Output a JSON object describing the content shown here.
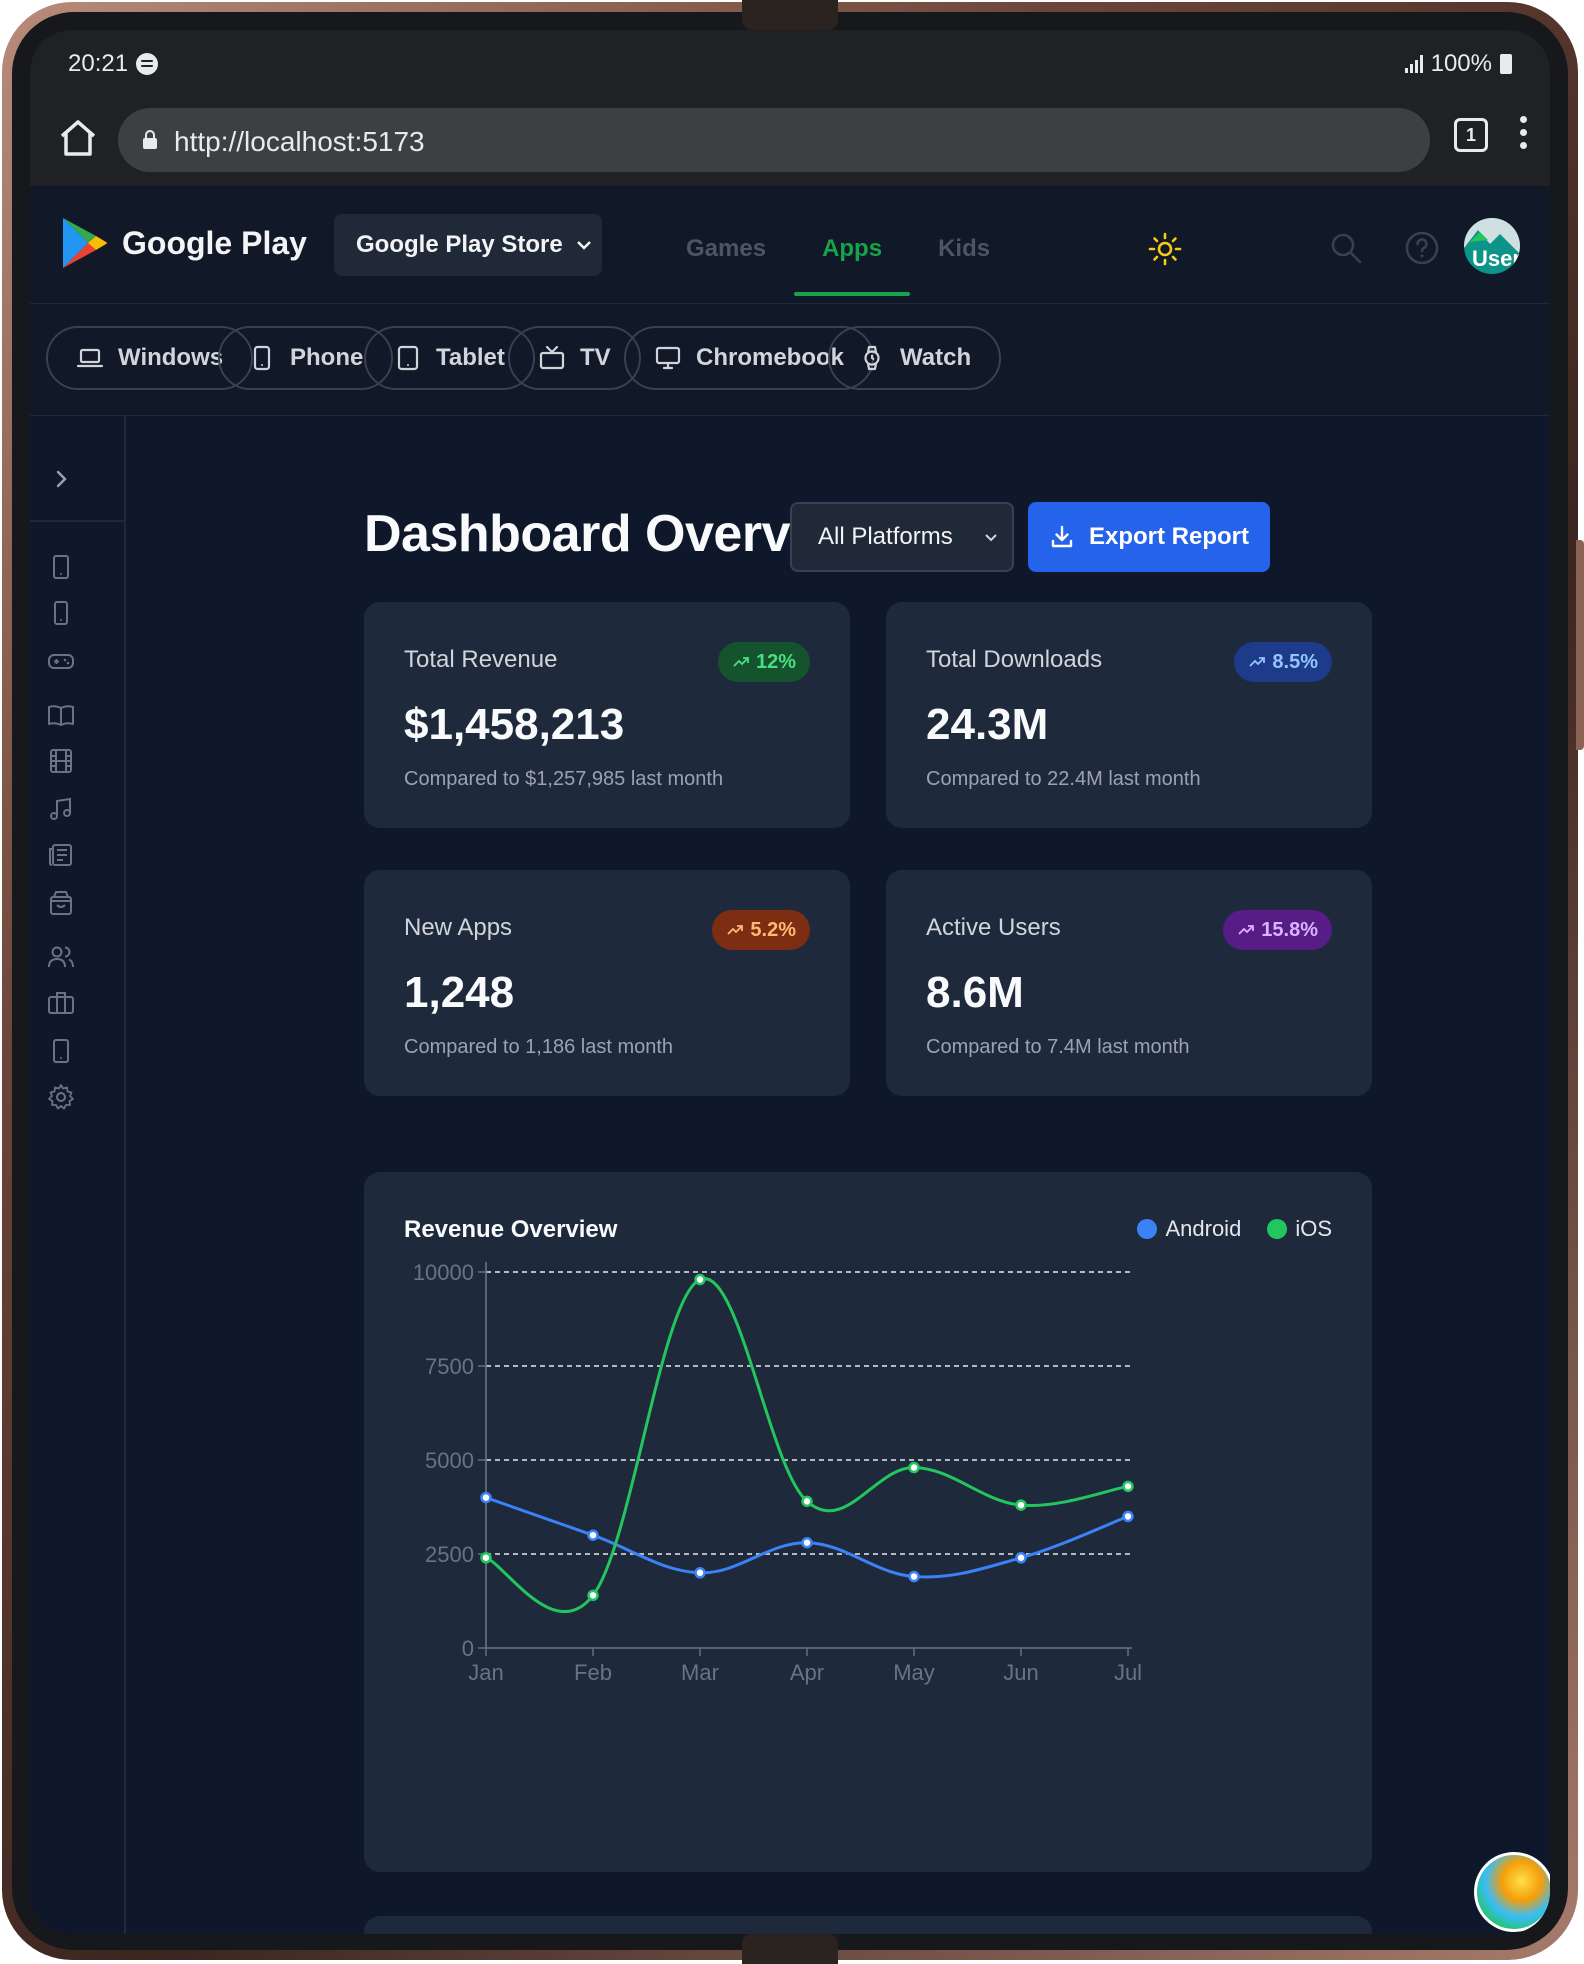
{
  "status_bar": {
    "time": "20:21",
    "battery": "100%"
  },
  "browser": {
    "url": "http://localhost:5173",
    "tab_count": "1"
  },
  "header": {
    "brand": "Google Play",
    "store_select": "Google Play Store",
    "tabs": [
      {
        "label": "Games",
        "active": false
      },
      {
        "label": "Apps",
        "active": true
      },
      {
        "label": "Kids",
        "active": false
      }
    ],
    "avatar_text": "User"
  },
  "devices": [
    {
      "label": "Windows",
      "icon": "laptop-icon"
    },
    {
      "label": "Phone",
      "icon": "phone-icon"
    },
    {
      "label": "Tablet",
      "icon": "tablet-icon"
    },
    {
      "label": "TV",
      "icon": "tv-icon"
    },
    {
      "label": "Chromebook",
      "icon": "monitor-icon"
    },
    {
      "label": "Watch",
      "icon": "watch-icon"
    }
  ],
  "sidebar": {
    "icons": [
      "tablet-icon",
      "phone-icon",
      "gamepad-icon",
      "book-icon",
      "film-icon",
      "music-icon",
      "newspaper-icon",
      "shopping-bag-icon",
      "users-icon",
      "briefcase-icon",
      "tablet-icon",
      "settings-icon"
    ]
  },
  "dashboard": {
    "title": "Dashboard Overview",
    "platform_select": "All Platforms",
    "export_label": "Export Report"
  },
  "stats": [
    {
      "label": "Total Revenue",
      "value": "$1,458,213",
      "compare": "Compared to $1,257,985 last month",
      "change": "12%",
      "badge_bg": "#14532d",
      "badge_fg": "#4ade80"
    },
    {
      "label": "Total Downloads",
      "value": "24.3M",
      "compare": "Compared to 22.4M last month",
      "change": "8.5%",
      "badge_bg": "#1e3a8a",
      "badge_fg": "#93c5fd"
    },
    {
      "label": "New Apps",
      "value": "1,248",
      "compare": "Compared to 1,186 last month",
      "change": "5.2%",
      "badge_bg": "#7c2d12",
      "badge_fg": "#fdba74"
    },
    {
      "label": "Active Users",
      "value": "8.6M",
      "compare": "Compared to 7.4M last month",
      "change": "15.8%",
      "badge_bg": "#581c87",
      "badge_fg": "#d8b4fe"
    }
  ],
  "chart_data": {
    "type": "line",
    "title": "Revenue Overview",
    "categories": [
      "Jan",
      "Feb",
      "Mar",
      "Apr",
      "May",
      "Jun",
      "Jul"
    ],
    "series": [
      {
        "name": "Android",
        "color": "#3b82f6",
        "values": [
          4000,
          3000,
          2000,
          2800,
          1900,
          2400,
          3500
        ]
      },
      {
        "name": "iOS",
        "color": "#22c55e",
        "values": [
          2400,
          1400,
          9800,
          3900,
          4800,
          3800,
          4300
        ]
      }
    ],
    "yticks": [
      "0",
      "2500",
      "5000",
      "7500",
      "10000"
    ],
    "ylim": [
      0,
      10000
    ],
    "grid": true,
    "legend_position": "top-right"
  }
}
